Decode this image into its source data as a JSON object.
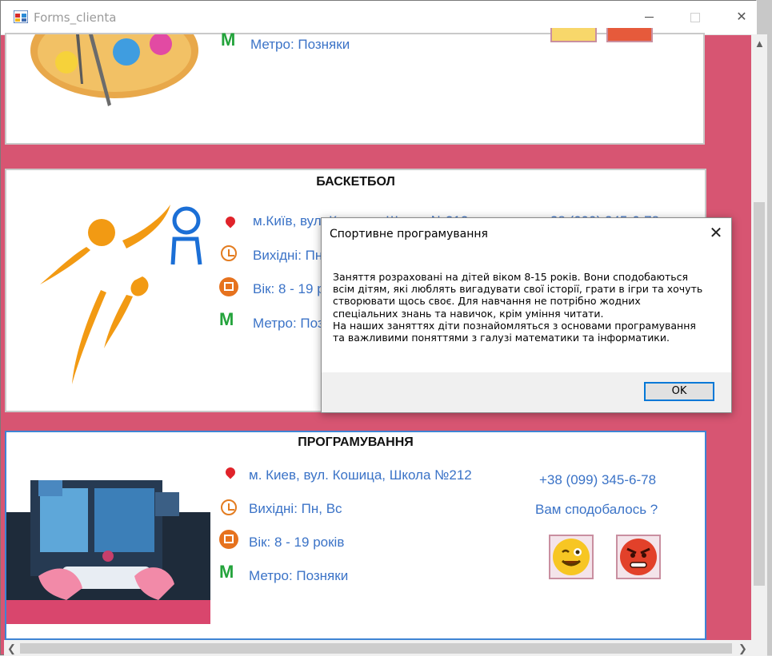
{
  "window": {
    "title": "Forms_clienta",
    "minimize_icon": "minimize-icon",
    "maximize_icon": "maximize-icon",
    "close_icon": "close-icon",
    "close_glyph": "✕"
  },
  "colors": {
    "background": "#d75572",
    "link_text": "#3b73c7",
    "metro": "#23a33b",
    "pin": "#e0232a",
    "clock": "#e37c20",
    "calendar": "#e6721e"
  },
  "cards": {
    "art": {
      "metro": "Метро: Позняки"
    },
    "basketball": {
      "title": "БАСКЕТБОЛ",
      "address": "м.Київ, вул. Кошица, Школа №212",
      "days": "Вихідні: Пн, Вс",
      "age": "Вік: 8 - 19 років",
      "metro": "Метро: Позняки",
      "phone": "+38 (099) 345-6-78"
    },
    "programming": {
      "title": "ПРОГРАМУВАННЯ",
      "address": "м. Киев, вул. Кошица, Школа №212",
      "days": "Вихідні: Пн, Вс",
      "age": "Вік: 8 - 19 років",
      "metro": "Метро: Позняки",
      "phone": "+38 (099) 345-6-78",
      "like_question": "Вам сподобалось ?",
      "metro_logo": "M"
    }
  },
  "dialog": {
    "title": "Спортивне програмування",
    "message": "Заняття розраховані на дітей віком 8-15 років. Вони сподобаються\nвсім дітям, які люблять вигадувати свої історії, грати в ігри та хочуть\nстворювати щось своє. Для навчання не потрібно жодних\nспеціальних знань та навичок, крім уміння читати.\nНа наших заняттях діти познайомляться з основами програмування\nта важливими поняттями з галузі математики та інформатики.",
    "ok_label": "OK",
    "close_glyph": "✕"
  },
  "scrollbars": {
    "up": "▲",
    "left": "❮",
    "right": "❯"
  }
}
